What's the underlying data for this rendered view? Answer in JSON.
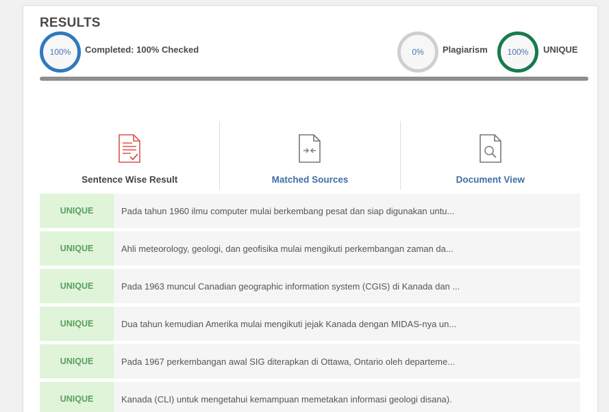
{
  "results": {
    "title": "RESULTS",
    "completed": {
      "percent_label": "100%",
      "label": "Completed: 100% Checked"
    },
    "plagiarism": {
      "percent_label": "0%",
      "label": "Plagiarism"
    },
    "unique": {
      "percent_label": "100%",
      "label": "UNIQUE"
    },
    "progress_fraction": 1.0
  },
  "tabs": [
    {
      "label": "Sentence Wise Result",
      "icon": "document-check-icon",
      "active": true
    },
    {
      "label": "Matched Sources",
      "icon": "document-compare-icon",
      "active": false
    },
    {
      "label": "Document View",
      "icon": "document-search-icon",
      "active": false
    }
  ],
  "sentences": [
    {
      "status": "UNIQUE",
      "text": "Pada tahun 1960 ilmu computer mulai berkembang pesat dan siap digunakan untu..."
    },
    {
      "status": "UNIQUE",
      "text": "Ahli meteorology, geologi, dan geofisika mulai mengikuti perkembangan zaman da..."
    },
    {
      "status": "UNIQUE",
      "text": "Pada 1963 muncul Canadian geographic information system (CGIS) di Kanada dan ..."
    },
    {
      "status": "UNIQUE",
      "text": "Dua tahun kemudian Amerika mulai mengikuti jejak Kanada dengan MIDAS-nya un..."
    },
    {
      "status": "UNIQUE",
      "text": "Pada 1967 perkembangan awal SIG diterapkan di Ottawa, Ontario oleh departeme..."
    },
    {
      "status": "UNIQUE",
      "text": "Kanada (CLI) untuk mengetahui kemampuan memetakan informasi geologi disana)."
    }
  ],
  "colors": {
    "completed_ring": "#2f79bd",
    "plagiarism_ring": "#cfcfcf",
    "unique_ring": "#177a4c",
    "unique_badge_bg": "#dff4d8",
    "unique_badge_text": "#58a05f",
    "link": "#3f6fa5",
    "icon_red": "#d9534f",
    "icon_gray": "#777777"
  }
}
